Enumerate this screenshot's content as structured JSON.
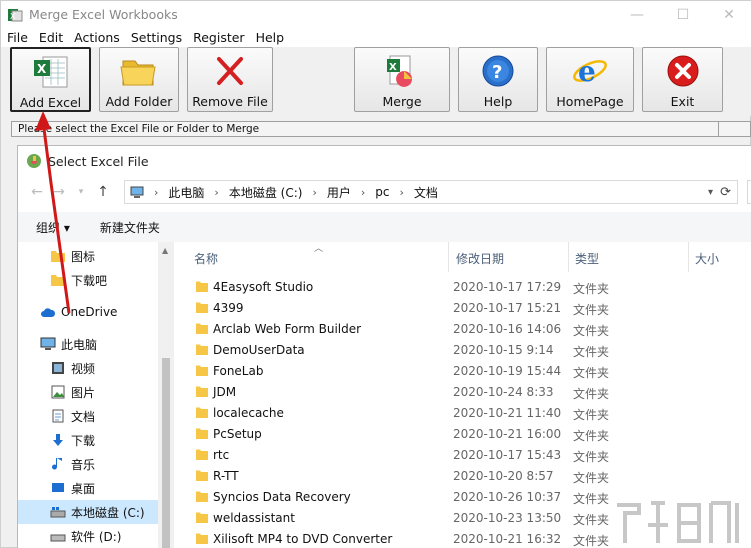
{
  "window": {
    "title": "Merge Excel Workbooks",
    "controls": {
      "minimize": "—",
      "maximize": "☐",
      "close": "✕"
    }
  },
  "menu": [
    "File",
    "Edit",
    "Actions",
    "Settings",
    "Register",
    "Help"
  ],
  "toolbar": {
    "add_excel": "Add Excel",
    "add_folder": "Add Folder",
    "remove_file": "Remove File",
    "merge": "Merge",
    "help": "Help",
    "homepage": "HomePage",
    "exit": "Exit"
  },
  "status": {
    "text": "Please select the Excel File or Folder to Merge"
  },
  "dialog": {
    "title": "Select Excel File",
    "address": [
      "此电脑",
      "本地磁盘 (C:)",
      "用户",
      "pc",
      "文档"
    ],
    "commands": {
      "organize": "组织 ▾",
      "new_folder": "新建文件夹"
    },
    "nav": [
      {
        "label": "图标",
        "icon": "folder-icon"
      },
      {
        "label": "下载吧",
        "icon": "folder-icon"
      },
      {
        "label": "OneDrive",
        "icon": "cloud-icon"
      },
      {
        "label": "此电脑",
        "icon": "computer-icon"
      },
      {
        "label": "视频",
        "icon": "video-icon"
      },
      {
        "label": "图片",
        "icon": "pictures-icon"
      },
      {
        "label": "文档",
        "icon": "document-icon"
      },
      {
        "label": "下载",
        "icon": "download-icon"
      },
      {
        "label": "音乐",
        "icon": "music-icon"
      },
      {
        "label": "桌面",
        "icon": "desktop-icon"
      },
      {
        "label": "本地磁盘 (C:)",
        "icon": "drive-icon"
      },
      {
        "label": "软件 (D:)",
        "icon": "drive-icon"
      }
    ],
    "columns": {
      "name": "名称",
      "date": "修改日期",
      "type": "类型",
      "size": "大小"
    },
    "files": [
      {
        "name": "4Easysoft Studio",
        "date": "2020-10-17 17:29",
        "type": "文件夹"
      },
      {
        "name": "4399",
        "date": "2020-10-17 15:21",
        "type": "文件夹"
      },
      {
        "name": "Arclab Web Form Builder",
        "date": "2020-10-16 14:06",
        "type": "文件夹"
      },
      {
        "name": "DemoUserData",
        "date": "2020-10-15 9:14",
        "type": "文件夹"
      },
      {
        "name": "FoneLab",
        "date": "2020-10-19 15:44",
        "type": "文件夹"
      },
      {
        "name": "JDM",
        "date": "2020-10-24 8:33",
        "type": "文件夹"
      },
      {
        "name": "localecache",
        "date": "2020-10-21 11:40",
        "type": "文件夹"
      },
      {
        "name": "PcSetup",
        "date": "2020-10-21 16:00",
        "type": "文件夹"
      },
      {
        "name": "rtc",
        "date": "2020-10-17 15:43",
        "type": "文件夹"
      },
      {
        "name": "R-TT",
        "date": "2020-10-20 8:57",
        "type": "文件夹"
      },
      {
        "name": "Syncios Data Recovery",
        "date": "2020-10-26 10:37",
        "type": "文件夹"
      },
      {
        "name": "weldassistant",
        "date": "2020-10-23 13:50",
        "type": "文件夹"
      },
      {
        "name": "Xilisoft MP4 to DVD Converter",
        "date": "2020-10-21 16:32",
        "type": "文件夹"
      }
    ]
  },
  "colors": {
    "folder": "#f6c747",
    "selection": "#cce8ff",
    "annotation_arrow": "#d01818"
  }
}
